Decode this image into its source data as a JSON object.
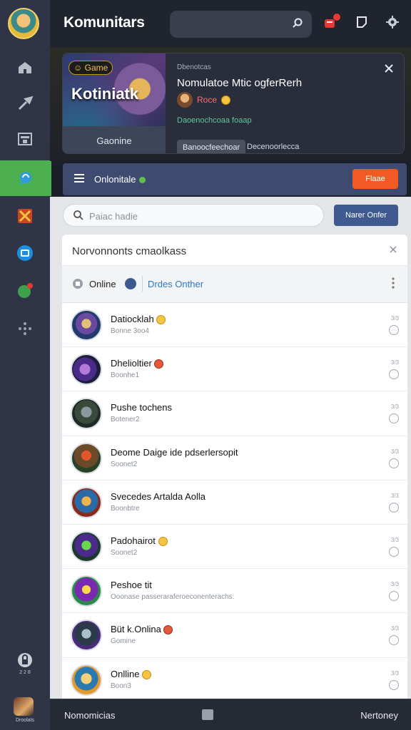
{
  "app": {
    "title": "Komunitars"
  },
  "colors": {
    "accent": "#4caf50",
    "sidebar": "#2f3547",
    "orange": "#f15a22",
    "blue_button": "#3e5a8e",
    "link": "#2a78c5"
  },
  "sidebar": {
    "items": [
      {
        "icon": "home-icon"
      },
      {
        "icon": "tools-icon"
      },
      {
        "icon": "dashboard-icon"
      },
      {
        "icon": "chat-bubble-icon",
        "active": true
      },
      {
        "icon": "game-tile-icon"
      },
      {
        "icon": "message-box-icon"
      },
      {
        "icon": "notification-bubble-icon"
      },
      {
        "icon": "dots-cluster-icon"
      },
      {
        "icon": "lock-icon",
        "label": "2 2 8"
      }
    ],
    "bottom_label": "Droolats"
  },
  "top": {
    "icons": [
      "search-icon",
      "alert-icon",
      "bookmark-icon",
      "settings-icon"
    ]
  },
  "promo": {
    "badge": "Game",
    "art_title": "Kotiniatk",
    "art_footer": "Gaonine",
    "kicker": "Dbenotcas",
    "title": "Nomulatoe Mtic ogferRerh",
    "highlight": "Roce",
    "green_text": "Daoenochcoaa foaap",
    "chip": "Banoocfeechoar",
    "link": "Decenoorlecca"
  },
  "section": {
    "label": "Onlonitale",
    "button": "Flaae"
  },
  "search": {
    "placeholder": "Paiac hadie",
    "button": "Narer Onfer"
  },
  "card": {
    "title": "Norvonnonts cmaolkass",
    "filter_online": "Online",
    "filter_other": "Drdes Onther"
  },
  "friends": [
    {
      "name": "Datiocklah",
      "sub": "Bonne 3oo4",
      "time": "3/3",
      "emoji": "yellow"
    },
    {
      "name": "Dhelioltier",
      "sub": "Boonhe1",
      "time": "3/3",
      "emoji": "red"
    },
    {
      "name": "Pushe tochens",
      "sub": "Botener2",
      "time": "3/3",
      "emoji": ""
    },
    {
      "name": "Deome Daige ide pdserlersopit",
      "sub": "Soonet2",
      "time": "3/3",
      "emoji": ""
    },
    {
      "name": "Svecedes Artalda Aolla",
      "sub": "Boonbtre",
      "time": "3/3",
      "emoji": ""
    },
    {
      "name": "Padohairot",
      "sub": "Soonet2",
      "time": "3/3",
      "emoji": "yellow"
    },
    {
      "name": "Peshoe tit",
      "sub": "Ooonase passeraraferoeconenterachs:",
      "time": "3/3",
      "emoji": ""
    },
    {
      "name": "Büt k.Onlina",
      "sub": "Gomine",
      "time": "3/3",
      "emoji": "red"
    },
    {
      "name": "Onlline",
      "sub": "Boon3",
      "time": "3/3",
      "emoji": "yellow"
    }
  ],
  "bottom": {
    "left": "Nomomicias",
    "right": "Nertoney"
  }
}
